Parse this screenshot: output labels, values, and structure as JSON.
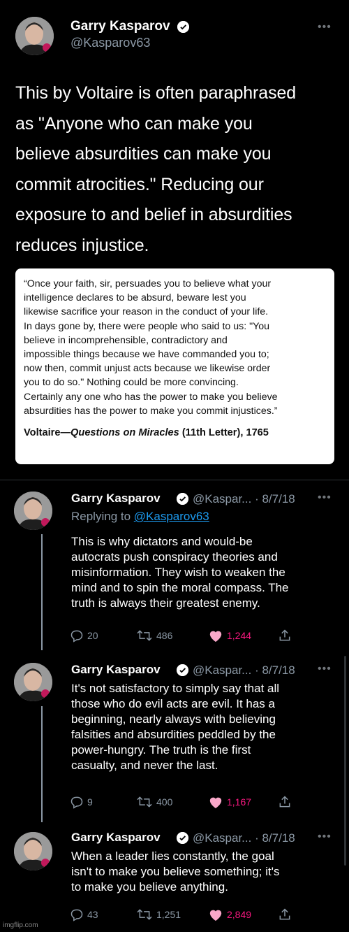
{
  "main_tweet": {
    "name": "Garry Kasparov",
    "handle": "@Kasparov63",
    "text_lines": [
      "This by Voltaire is often paraphrased",
      "as \"Anyone who can make you",
      "believe absurdities can make you",
      "commit atrocities.\" Reducing our",
      "exposure to and belief in absurdities",
      "reduces injustice."
    ],
    "quote_lines": [
      "“Once your faith, sir, persuades you to believe what your",
      "intelligence declares to be absurd, beware lest you",
      "likewise sacrifice your reason in the conduct of your life.",
      "In days gone by, there were people who said to us: \"You",
      "believe in incomprehensible, contradictory and",
      "impossible things because we have commanded you to;",
      "now then, commit unjust acts because we likewise order",
      "you to do so.\" Nothing could be more convincing.",
      "Certainly any one who has the power to make you believe",
      "absurdities has the power to make you commit injustices.”"
    ],
    "quote_source_author": "Voltaire—",
    "quote_source_title": "Questions on Miracles",
    "quote_source_rest": " (11th Letter), 1765"
  },
  "replies": [
    {
      "name": "Garry Kasparov",
      "meta": "@Kaspar... · 8/7/18",
      "replying_prefix": "Replying to ",
      "replying_handle": "@Kasparov63",
      "text_lines": [
        "This is why dictators and would-be",
        "autocrats push conspiracy theories and",
        "misinformation. They wish to weaken the",
        "mind and to spin the moral compass. The",
        "truth is always their greatest enemy."
      ],
      "replies": "20",
      "retweets": "486",
      "likes": "1,244"
    },
    {
      "name": "Garry Kasparov",
      "meta": "@Kaspar... · 8/7/18",
      "text_lines": [
        "It's not satisfactory to simply say that all",
        "those who do evil acts are evil. It has a",
        "beginning, nearly always with believing",
        "falsities and absurdities peddled by the",
        "power-hungry. The truth is the first",
        "casualty, and never the last."
      ],
      "replies": "9",
      "retweets": "400",
      "likes": "1,167"
    },
    {
      "name": "Garry Kasparov",
      "meta": "@Kaspar... · 8/7/18",
      "text_lines": [
        "When a leader lies constantly, the goal",
        "isn't to make you believe something; it's",
        "to make you believe anything."
      ],
      "replies": "43",
      "retweets": "1,251",
      "likes": "2,849"
    }
  ],
  "more_label": "•••",
  "watermark": "imgflip.com",
  "colors": {
    "background": "#000000",
    "verified": "#ffffff",
    "secondary_text": "#8b98a5",
    "link": "#1d9bf0",
    "like": "#f91880"
  }
}
